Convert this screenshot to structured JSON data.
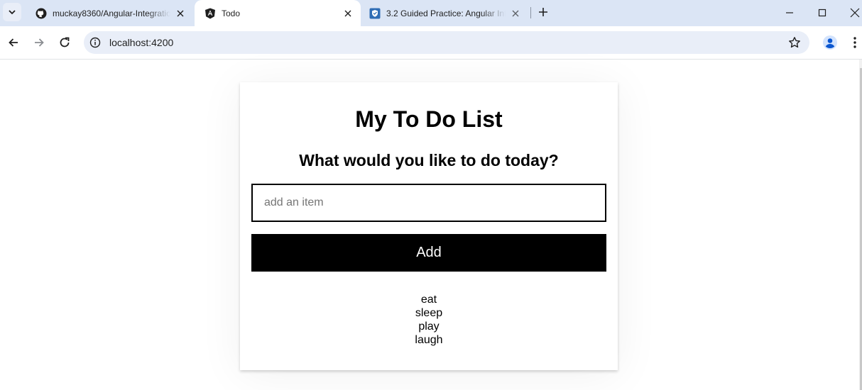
{
  "browser": {
    "tabs": [
      {
        "title": "muckay8360/Angular-Integratio",
        "favicon": "github-icon",
        "active": false
      },
      {
        "title": "Todo",
        "favicon": "angular-icon",
        "active": true
      },
      {
        "title": "3.2 Guided Practice: Angular Int",
        "favicon": "course-shield-icon",
        "active": false
      }
    ],
    "url": "localhost:4200"
  },
  "app": {
    "title": "My To Do List",
    "subtitle": "What would you like to do today?",
    "input_placeholder": "add an item",
    "input_value": "",
    "add_button_label": "Add",
    "items": [
      "eat",
      "sleep",
      "play",
      "laugh"
    ]
  },
  "colors": {
    "tabstrip": "#dbe5f5",
    "omnibox": "#e9eef8",
    "button_bg": "#000000",
    "button_text": "#ffffff"
  }
}
